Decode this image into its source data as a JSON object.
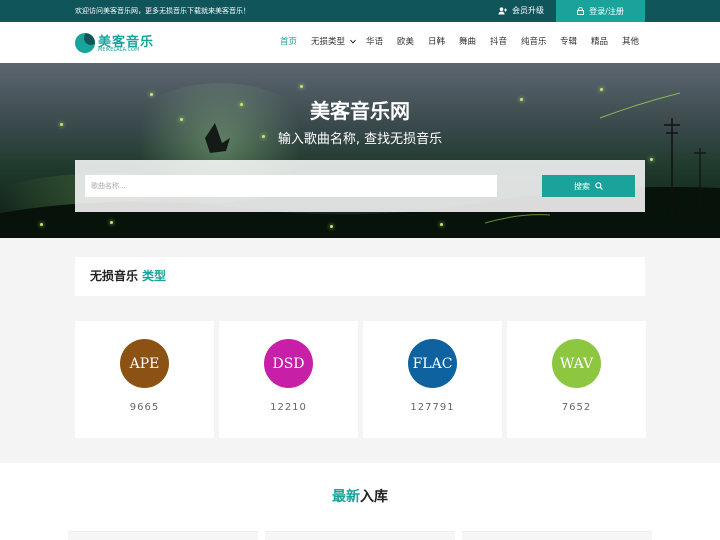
{
  "topbar": {
    "welcome": "欢迎访问美客音乐网，更多无损音乐下载就来美客音乐！",
    "vip_label": "会员升级",
    "login_label": "登录/注册"
  },
  "logo": {
    "name_cn": "美客音乐",
    "name_en": "MEIKELALA.COM"
  },
  "nav": {
    "items": [
      {
        "label": "首页",
        "active": true
      },
      {
        "label": "无损类型",
        "dropdown": true
      },
      {
        "label": "华语"
      },
      {
        "label": "欧美"
      },
      {
        "label": "日韩"
      },
      {
        "label": "舞曲"
      },
      {
        "label": "抖音"
      },
      {
        "label": "纯音乐"
      },
      {
        "label": "专辑"
      },
      {
        "label": "精品"
      },
      {
        "label": "其他"
      }
    ]
  },
  "hero": {
    "title": "美客音乐网",
    "subtitle": "输入歌曲名称, 查找无损音乐",
    "search_placeholder": "歌曲名称...",
    "search_button": "搜索"
  },
  "types_section": {
    "title": "无损音乐",
    "accent": "类型"
  },
  "types": [
    {
      "name": "APE",
      "count": "9665",
      "color": "#8b5214"
    },
    {
      "name": "DSD",
      "count": "12210",
      "color": "#c81fa8"
    },
    {
      "name": "FLAC",
      "count": "127791",
      "color": "#0e62a0"
    },
    {
      "name": "WAV",
      "count": "7652",
      "color": "#8dc63f"
    }
  ],
  "latest_section": {
    "accent": "最新",
    "title": "入库"
  },
  "colors": {
    "brand": "#1aa39a",
    "topbar": "#0f5559"
  }
}
